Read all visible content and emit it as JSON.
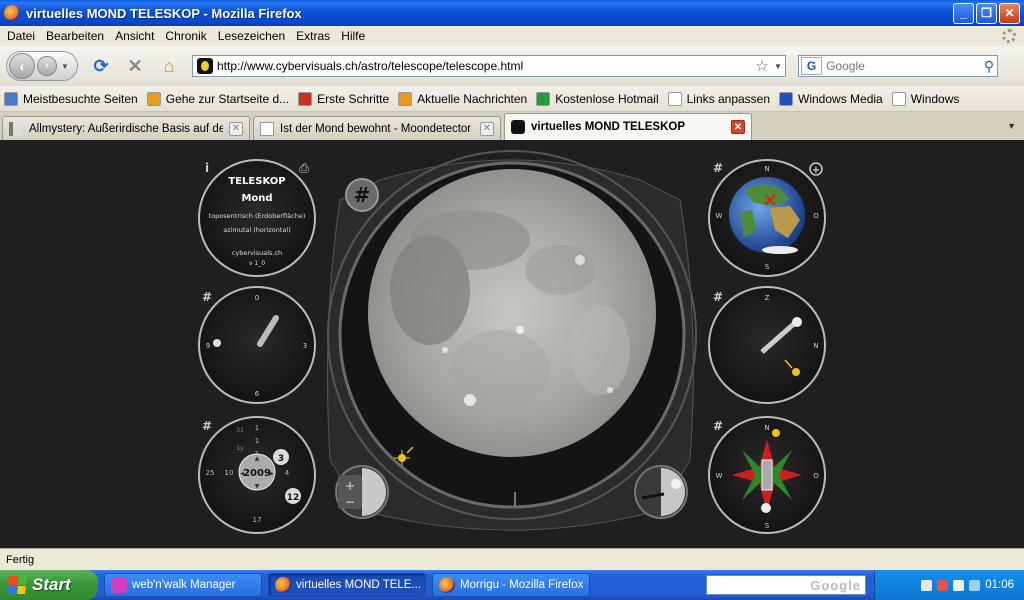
{
  "window": {
    "title": "virtuelles MOND TELESKOP - Mozilla Firefox",
    "minimize": "_",
    "maximize": "❐",
    "close": "✕"
  },
  "menu": [
    "Datei",
    "Bearbeiten",
    "Ansicht",
    "Chronik",
    "Lesezeichen",
    "Extras",
    "Hilfe"
  ],
  "nav": {
    "back": "‹",
    "forward": "›",
    "reload": "⟳",
    "stop": "✕",
    "home": "⌂",
    "url": "http://www.cybervisuals.ch/astro/telescope/telescope.html",
    "search_engine": "G",
    "search_placeholder": "Google"
  },
  "bookmarks": [
    {
      "label": "Meistbesuchte Seiten",
      "color": "#4a78c8"
    },
    {
      "label": "Gehe zur Startseite d...",
      "color": "#e0a020"
    },
    {
      "label": "Erste Schritte",
      "color": "#c83020"
    },
    {
      "label": "Aktuelle Nachrichten",
      "color": "#e89a20"
    },
    {
      "label": "Kostenlose Hotmail",
      "color": "#2a9a3a"
    },
    {
      "label": "Links anpassen",
      "color": "#ffffff"
    },
    {
      "label": "Windows Media",
      "color": "#2050b8"
    },
    {
      "label": "Windows",
      "color": "#ffffff"
    }
  ],
  "tabs": [
    {
      "label": "Allmystery: Außerirdische Basis auf de...",
      "active": false
    },
    {
      "label": "Ist der Mond bewohnt - Moondetector",
      "active": false
    },
    {
      "label": "virtuelles MOND TELESKOP",
      "active": true
    }
  ],
  "telescope": {
    "info_title": "TELESKOP",
    "info_object": "Mond",
    "info_line1": "toposentrisch (Erdoberfläche)",
    "info_line2": "azimutal (horizontal)",
    "info_site": "cybervisuals.ch",
    "info_version": "v 1_0",
    "clock": {
      "top": "0",
      "right": "3",
      "bottom": "6",
      "left": "9"
    },
    "date": {
      "year": "2009",
      "day": "3",
      "month": "12",
      "ring_top1": "1",
      "ring_top2": "31",
      "ring_top3": "1",
      "ring_top4": "1",
      "ring_left1": "25",
      "ring_left2": "10",
      "ring_right1": "4",
      "ring_bottom1": "17",
      "ring_up": "▲",
      "ring_down": "▼",
      "ring_arrow_left": "◀",
      "ring_arrow_right": "▶",
      "label_yr": "1y"
    },
    "compass": {
      "n": "N",
      "s": "S",
      "w": "W",
      "o": "O",
      "z": "Z"
    },
    "hash": "#",
    "info_icon": "i",
    "print_icon": "⎙",
    "zoom_plus": "+",
    "zoom_minus": "−"
  },
  "status": "Fertig",
  "taskbar": {
    "start": "Start",
    "items": [
      {
        "label": "web'n'walk Manager",
        "active": false
      },
      {
        "label": "virtuelles MOND TELE...",
        "active": true
      },
      {
        "label": "Morrigu - Mozilla Firefox",
        "active": false
      }
    ],
    "search": "Google",
    "clock": "01:06"
  }
}
